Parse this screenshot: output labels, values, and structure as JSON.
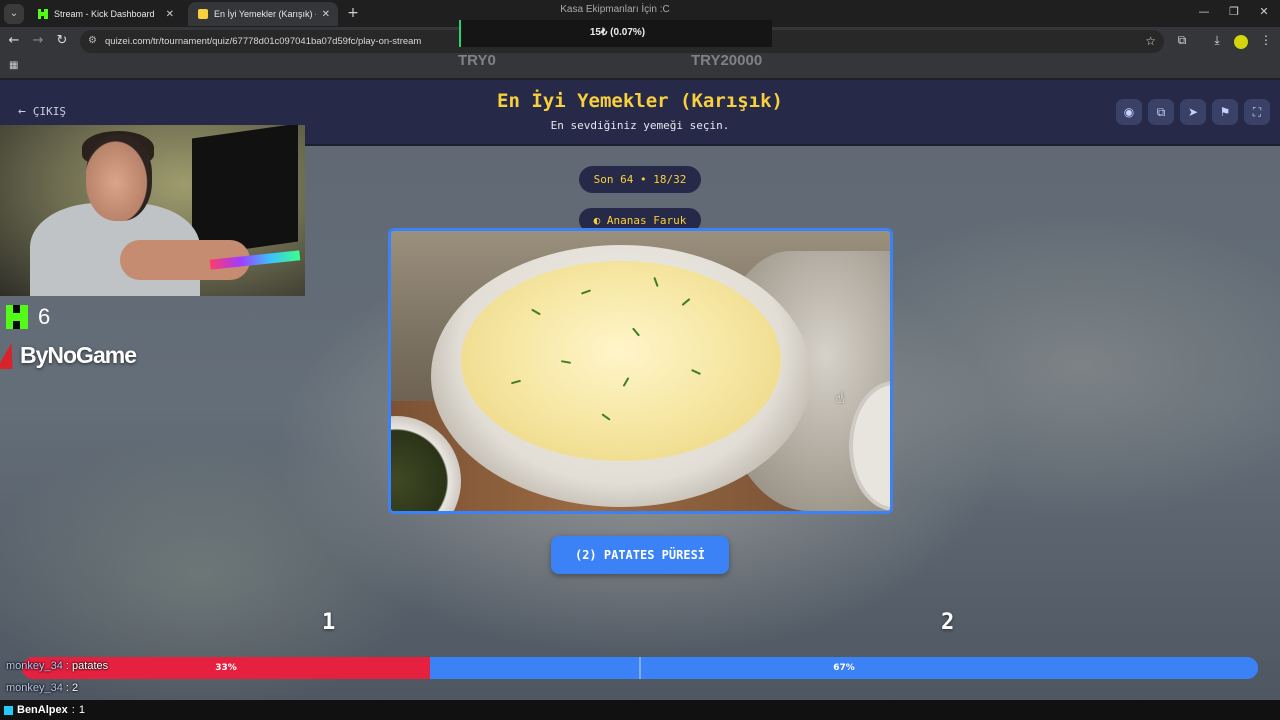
{
  "browser": {
    "tabs": [
      {
        "title": "Stream - Kick Dashboard",
        "favicon_color": "#53fc18"
      },
      {
        "title": "En İyi Yemekler (Karışık) - Quiz",
        "favicon_color": "#f8cf3c"
      }
    ],
    "window_title": "Kasa Ekipmanları İçin :C",
    "url": "quizei.com/tr/tournament/quiz/67778d01c097041ba07d59fc/play-on-stream"
  },
  "donation_widget": {
    "amount_text": "15₺ (0.07%)",
    "label_min": "TRY0",
    "label_max": "TRY20000"
  },
  "quiz": {
    "exit_label": "ÇIKIŞ",
    "title": "En İyi Yemekler (Karışık)",
    "subtitle": "En sevdiğiniz yemeği seçin.",
    "round_label": "Son 64 • 18/32",
    "author": "Ananas Faruk",
    "answer_label": "(2) PATATES PÜRESİ",
    "header_icons": [
      "eye-icon",
      "external-link-icon",
      "send-icon",
      "flag-icon",
      "fullscreen-icon"
    ],
    "vote": {
      "option1_label": "1",
      "option2_label": "2",
      "option1_percent": 33,
      "option2_percent": 67,
      "option1_text": "33%",
      "option2_text": "67%"
    },
    "colors": {
      "accent": "#3b82f6",
      "title": "#f8cf3c",
      "vote_red": "#e5213f"
    }
  },
  "stream": {
    "viewer_count": "6",
    "sponsor": "ByNoGame",
    "chat": [
      {
        "user": "monkey_34",
        "message": "patates"
      },
      {
        "user": "monkey_34",
        "message": "2"
      },
      {
        "user": "BenAlpex",
        "message": "1"
      }
    ]
  }
}
